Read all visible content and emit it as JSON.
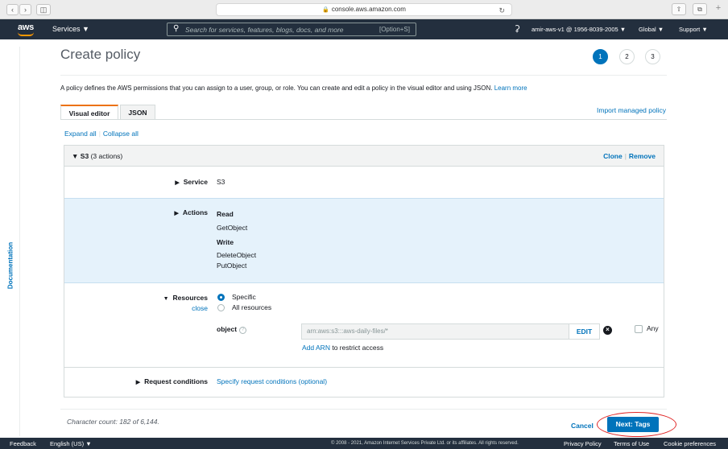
{
  "browser": {
    "url": "console.aws.amazon.com",
    "back_icon": "chevron-left-icon",
    "forward_icon": "chevron-right-icon",
    "sidebar_icon": "sidebar-icon",
    "reload_icon": "reload-icon",
    "share_icon": "share-icon",
    "tabs_icon": "tabs-icon",
    "new_tab_icon": "plus-icon"
  },
  "header": {
    "logo": "aws",
    "services": "Services",
    "search_placeholder": "Search for services, features, blogs, docs, and more",
    "search_shortcut": "[Option+S]",
    "account": "amir-aws-v1 @ 1956-8039-2005",
    "region": "Global",
    "support": "Support"
  },
  "side_tab": {
    "label": "Documentation"
  },
  "page": {
    "title": "Create policy",
    "steps": [
      "1",
      "2",
      "3"
    ],
    "active_step": 1,
    "intro": "A policy defines the AWS permissions that you can assign to a user, group, or role. You can create and edit a policy in the visual editor and using JSON.",
    "learn_more": "Learn more",
    "tabs": [
      "Visual editor",
      "JSON"
    ],
    "import_link": "Import managed policy",
    "expand_all": "Expand all",
    "collapse_all": "Collapse all"
  },
  "statement": {
    "service_name": "S3",
    "action_count": "(3 actions)",
    "clone": "Clone",
    "remove": "Remove",
    "service_label": "Service",
    "service_value": "S3",
    "actions_label": "Actions",
    "read_heading": "Read",
    "read_actions": [
      "GetObject"
    ],
    "write_heading": "Write",
    "write_actions": [
      "DeleteObject",
      "PutObject"
    ],
    "resources_label": "Resources",
    "resources_close": "close",
    "resource_options": [
      "Specific",
      "All resources"
    ],
    "selected_resource_option": "Specific",
    "object_label": "object",
    "arn_value": "arn:aws:s3:::aws-daily-files/*",
    "edit": "EDIT",
    "any": "Any",
    "add_arn_link": "Add ARN",
    "add_arn_suffix": "to restrict access",
    "request_conditions_label": "Request conditions",
    "request_conditions_link": "Specify request conditions (optional)"
  },
  "footer_bar": {
    "char_count": "Character count: 182 of 6,144.",
    "cancel": "Cancel",
    "next": "Next: Tags"
  },
  "bottom_footer": {
    "feedback": "Feedback",
    "language": "English (US)",
    "copyright": "© 2008 - 2021, Amazon Internet Services Private Ltd. or its affiliates. All rights reserved.",
    "privacy": "Privacy Policy",
    "terms": "Terms of Use",
    "cookies": "Cookie preferences"
  },
  "colors": {
    "nav_bg": "#232f3e",
    "accent_blue": "#0073bb",
    "tab_orange": "#ec7211",
    "highlight_row": "#e5f2fb",
    "annotation_red": "#e02424"
  }
}
